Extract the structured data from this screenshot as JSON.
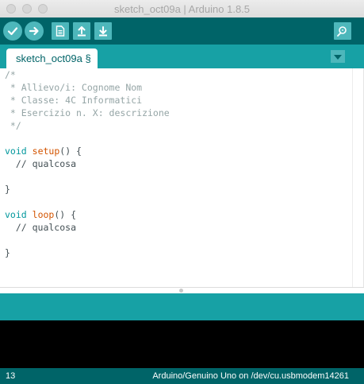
{
  "window": {
    "title": "sketch_oct09a | Arduino 1.8.5"
  },
  "toolbar": {
    "buttons": [
      {
        "icon": "check-icon"
      },
      {
        "icon": "arrow-right-icon"
      },
      {
        "icon": "new-file-icon"
      },
      {
        "icon": "open-arrow-up-icon"
      },
      {
        "icon": "save-arrow-down-icon"
      },
      {
        "icon": "serial-monitor-icon"
      }
    ]
  },
  "tabs": {
    "active_tab": "sketch_oct09a §",
    "menu_icon": "triangle-down-icon"
  },
  "editor": {
    "lines": [
      {
        "comment": "/*"
      },
      {
        "comment": " * Allievo/i: Cognome Nom"
      },
      {
        "comment": " * Classe: 4C Informatici"
      },
      {
        "comment": " * Esercizio n. X: descrizione"
      },
      {
        "comment": " */"
      },
      {},
      {
        "keyword": "void",
        "fn": "setup",
        "rest": "() {"
      },
      {
        "text": "  // qualcosa"
      },
      {},
      {
        "text": "}"
      },
      {},
      {
        "keyword": "void",
        "fn": "loop",
        "rest": "() {"
      },
      {
        "text": "  // qualcosa"
      },
      {},
      {
        "text": "}"
      }
    ]
  },
  "status": {
    "line_number": "13",
    "board_port": "Arduino/Genuino Uno on /dev/cu.usbmodem14261"
  },
  "colors": {
    "toolbar_bg": "#006468",
    "tabs_bg": "#17a1a5",
    "button_bg": "#4db7bb",
    "comment": "#95a5a6",
    "keyword": "#00979c",
    "function": "#d35400",
    "console_bg": "#000000"
  }
}
